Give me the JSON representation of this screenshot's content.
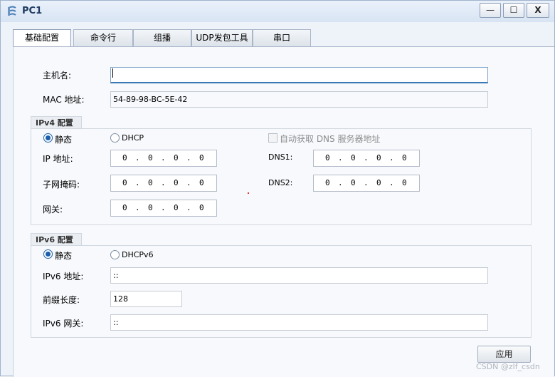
{
  "window": {
    "title": "PC1",
    "min_label": "—",
    "max_label": "☐",
    "close_label": "X"
  },
  "tabs": [
    "基础配置",
    "命令行",
    "组播",
    "UDP发包工具",
    "串口"
  ],
  "active_tab": 0,
  "host": {
    "label": "主机名:",
    "value": ""
  },
  "mac": {
    "label": "MAC 地址:",
    "value": "54-89-98-BC-5E-42"
  },
  "ipv4": {
    "title": "IPv4 配置",
    "static_label": "静态",
    "dhcp_label": "DHCP",
    "mode": "static",
    "auto_dns_label": "自动获取 DNS 服务器地址",
    "ip_label": "IP 地址:",
    "ip": [
      "0",
      "0",
      "0",
      "0"
    ],
    "mask_label": "子网掩码:",
    "mask": [
      "0",
      "0",
      "0",
      "0"
    ],
    "gw_label": "网关:",
    "gw": [
      "0",
      "0",
      "0",
      "0"
    ],
    "dns1_label": "DNS1:",
    "dns1": [
      "0",
      "0",
      "0",
      "0"
    ],
    "dns2_label": "DNS2:",
    "dns2": [
      "0",
      "0",
      "0",
      "0"
    ]
  },
  "ipv6": {
    "title": "IPv6 配置",
    "static_label": "静态",
    "dhcp_label": "DHCPv6",
    "mode": "static",
    "addr_label": "IPv6 地址:",
    "addr": "::",
    "prefix_label": "前缀长度:",
    "prefix": "128",
    "gw_label": "IPv6 网关:",
    "gw": "::"
  },
  "apply_label": "应用",
  "watermark": "CSDN @zlf_csdn"
}
